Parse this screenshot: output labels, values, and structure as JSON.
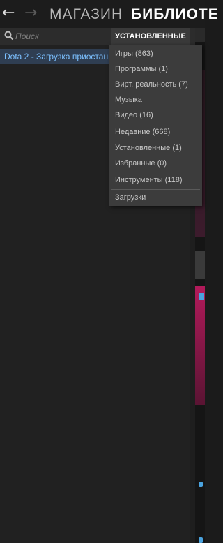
{
  "nav": {
    "back_icon": "arrow-left-icon",
    "forward_icon": "arrow-right-icon",
    "store_label": "МАГАЗИН",
    "library_label": "БИБЛИОТЕ"
  },
  "sidebar": {
    "search": {
      "icon": "search-icon",
      "placeholder": "Поиск"
    },
    "filter_button_label": "УСТАНОВЛЕННЫЕ",
    "items": [
      {
        "label": "Dota 2 - Загрузка приостан"
      }
    ]
  },
  "dropdown": {
    "groups": [
      {
        "items": [
          {
            "label": "Игры (863)"
          },
          {
            "label": "Программы (1)"
          },
          {
            "label": "Вирт. реальность (7)"
          },
          {
            "label": "Музыка"
          },
          {
            "label": "Видео (16)"
          }
        ]
      },
      {
        "items": [
          {
            "label": "Недавние (668)"
          },
          {
            "label": "Установленные (1)"
          },
          {
            "label": "Избранные (0)"
          }
        ]
      },
      {
        "items": [
          {
            "label": "Инструменты (118)"
          }
        ]
      },
      {
        "items": [
          {
            "label": "Загрузки"
          }
        ]
      }
    ]
  },
  "colors": {
    "background": "#1b1b1b",
    "sidebar": "#212121",
    "dropdown": "#3c3c3c",
    "selected_row": "#2f3e52",
    "selected_text": "#7cc0ff"
  }
}
